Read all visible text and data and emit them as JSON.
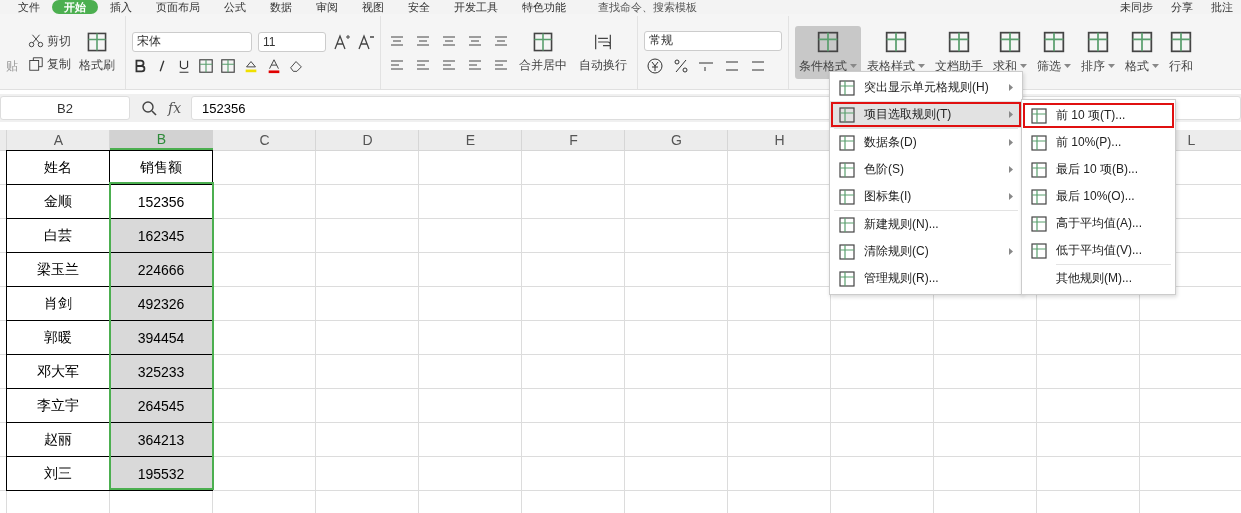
{
  "menu_tabs": [
    {
      "label": "文件",
      "selected": false
    },
    {
      "label": "开始",
      "selected": true
    },
    {
      "label": "插入",
      "selected": false
    },
    {
      "label": "页面布局",
      "selected": false
    },
    {
      "label": "公式",
      "selected": false
    },
    {
      "label": "数据",
      "selected": false
    },
    {
      "label": "审阅",
      "selected": false
    },
    {
      "label": "视图",
      "selected": false
    },
    {
      "label": "安全",
      "selected": false
    },
    {
      "label": "开发工具",
      "selected": false
    },
    {
      "label": "特色功能",
      "selected": false
    }
  ],
  "search": {
    "placeholder": "查找命令、搜索模板"
  },
  "top_right": [
    "未同步",
    "分享",
    "批注"
  ],
  "ribbon": {
    "paste": "贴",
    "cut": "剪切",
    "copy": "复制",
    "format_painter": "格式刷",
    "font_name": "宋体",
    "font_size": "11",
    "merge": "合并居中",
    "wrap": "自动换行",
    "number_format": "常规",
    "tools": [
      {
        "label": "条件格式",
        "selected": true,
        "dropdown": true
      },
      {
        "label": "表格样式",
        "selected": false,
        "dropdown": true
      },
      {
        "label": "文档助手",
        "selected": false,
        "dropdown": false
      },
      {
        "label": "求和",
        "selected": false,
        "dropdown": true
      },
      {
        "label": "筛选",
        "selected": false,
        "dropdown": true
      },
      {
        "label": "排序",
        "selected": false,
        "dropdown": true
      },
      {
        "label": "格式",
        "selected": false,
        "dropdown": true
      },
      {
        "label": "行和",
        "selected": false,
        "dropdown": false
      }
    ]
  },
  "name_box": "B2",
  "function_label": "fx",
  "formula": "152356",
  "columns": [
    {
      "label": "A",
      "selected": false
    },
    {
      "label": "B",
      "selected": true
    },
    {
      "label": "C",
      "selected": false
    },
    {
      "label": "D",
      "selected": false
    },
    {
      "label": "E",
      "selected": false
    },
    {
      "label": "F",
      "selected": false
    },
    {
      "label": "G",
      "selected": false
    },
    {
      "label": "H",
      "selected": false
    },
    {
      "label": "L",
      "selected": false
    }
  ],
  "header_row": [
    "姓名",
    "销售额"
  ],
  "rows": [
    {
      "name": "金顺",
      "sales": "152356",
      "selected": false
    },
    {
      "name": "白芸",
      "sales": "162345",
      "selected": true
    },
    {
      "name": "梁玉兰",
      "sales": "224666",
      "selected": true
    },
    {
      "name": "肖剑",
      "sales": "492326",
      "selected": true
    },
    {
      "name": "郭暖",
      "sales": "394454",
      "selected": true
    },
    {
      "name": "邓大军",
      "sales": "325233",
      "selected": true
    },
    {
      "name": "李立宇",
      "sales": "264545",
      "selected": true
    },
    {
      "name": "赵丽",
      "sales": "364213",
      "selected": true
    },
    {
      "name": "刘三",
      "sales": "195532",
      "selected": true
    }
  ],
  "menu": [
    {
      "kind": "item",
      "label": "突出显示单元格规则(H)",
      "submenu": true,
      "selected": false,
      "marked": false
    },
    {
      "kind": "item",
      "label": "项目选取规则(T)",
      "submenu": true,
      "selected": true,
      "marked": true
    },
    {
      "kind": "separator"
    },
    {
      "kind": "item",
      "label": "数据条(D)",
      "submenu": true,
      "selected": false,
      "marked": false
    },
    {
      "kind": "item",
      "label": "色阶(S)",
      "submenu": true,
      "selected": false,
      "marked": false
    },
    {
      "kind": "item",
      "label": "图标集(I)",
      "submenu": true,
      "selected": false,
      "marked": false
    },
    {
      "kind": "separator"
    },
    {
      "kind": "item",
      "label": "新建规则(N)...",
      "submenu": false,
      "selected": false,
      "marked": false
    },
    {
      "kind": "item",
      "label": "清除规则(C)",
      "submenu": true,
      "selected": false,
      "marked": false
    },
    {
      "kind": "item",
      "label": "管理规则(R)...",
      "submenu": false,
      "selected": false,
      "marked": false
    }
  ],
  "submenu": [
    {
      "kind": "item",
      "label": "前 10 项(T)...",
      "marked": true
    },
    {
      "kind": "item",
      "label": "前 10%(P)...",
      "marked": false
    },
    {
      "kind": "item",
      "label": "最后 10 项(B)...",
      "marked": false
    },
    {
      "kind": "item",
      "label": "最后 10%(O)...",
      "marked": false
    },
    {
      "kind": "item",
      "label": "高于平均值(A)...",
      "marked": false
    },
    {
      "kind": "item",
      "label": "低于平均值(V)...",
      "marked": false
    },
    {
      "kind": "separator"
    },
    {
      "kind": "plain",
      "label": "其他规则(M)...",
      "marked": false
    }
  ]
}
